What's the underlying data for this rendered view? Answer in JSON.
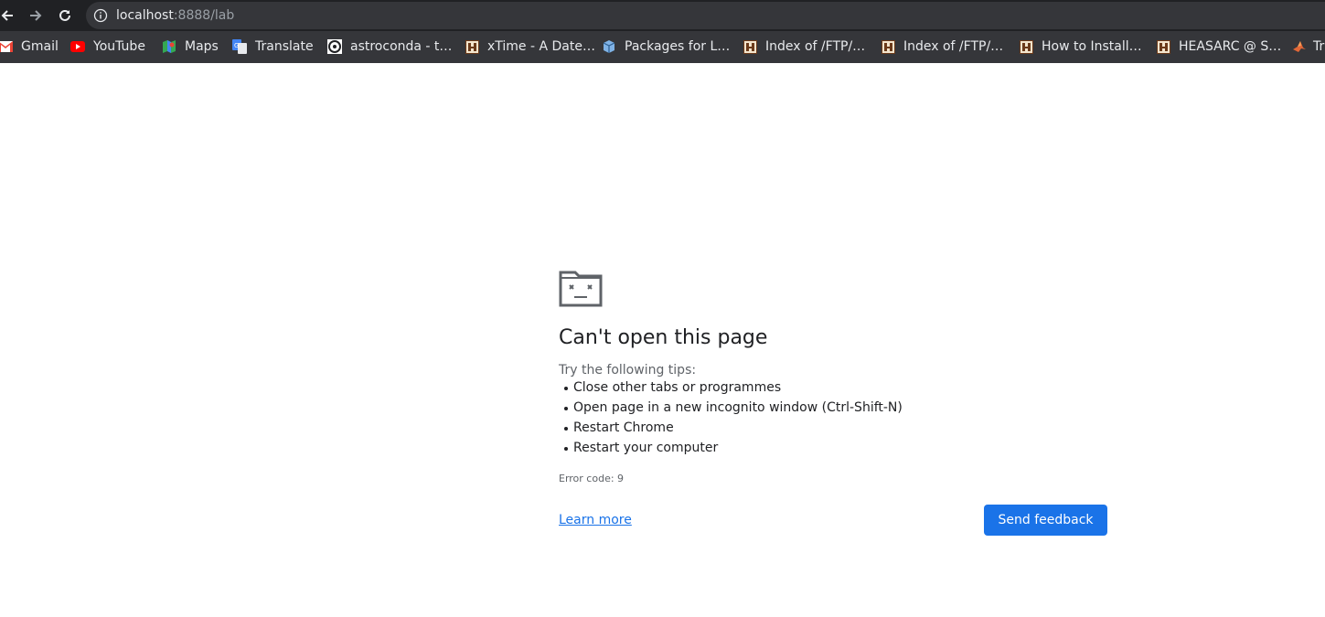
{
  "toolbar": {
    "back_icon": "arrow-left-icon",
    "forward_icon": "arrow-right-icon",
    "reload_icon": "reload-icon",
    "info_icon": "info-icon",
    "url_host": "localhost",
    "url_rest": ":8888/lab"
  },
  "bookmarks": [
    {
      "label": "Gmail",
      "icon": "gmail-icon"
    },
    {
      "label": "YouTube",
      "icon": "youtube-icon"
    },
    {
      "label": "Maps",
      "icon": "maps-icon"
    },
    {
      "label": "Translate",
      "icon": "translate-icon"
    },
    {
      "label": "astroconda - t…",
      "icon": "astroconda-icon"
    },
    {
      "label": "xTime - A Date…",
      "icon": "heasarc-icon"
    },
    {
      "label": "Packages for L…",
      "icon": "package-icon"
    },
    {
      "label": "Index of /FTP/…",
      "icon": "heasarc-icon"
    },
    {
      "label": "Index of /FTP/…",
      "icon": "heasarc-icon"
    },
    {
      "label": "How to Install…",
      "icon": "heasarc-icon"
    },
    {
      "label": "HEASARC @ S…",
      "icon": "heasarc-icon"
    },
    {
      "label": "Tr",
      "icon": "matlab-icon"
    }
  ],
  "error_page": {
    "icon": "sad-folder-icon",
    "title": "Can't open this page",
    "tips_heading": "Try the following tips:",
    "tips": [
      "Close other tabs or programmes",
      "Open page in a new incognito window (Ctrl-Shift-N)",
      "Restart Chrome",
      "Restart your computer"
    ],
    "error_code": "Error code: 9",
    "learn_more": "Learn more",
    "send_feedback": "Send feedback"
  },
  "colors": {
    "toolbar_bg": "#202124",
    "bookmarks_bg": "#35363a",
    "accent": "#1a73e8",
    "text_primary": "#202124",
    "text_secondary": "#5f6368"
  }
}
